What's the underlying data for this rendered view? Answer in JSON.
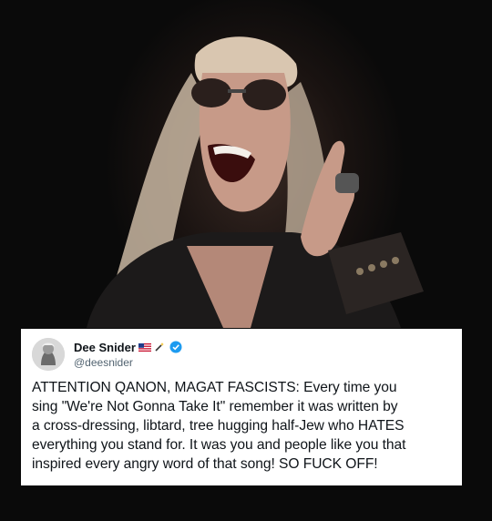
{
  "tweet": {
    "display_name": "Dee Snider",
    "handle": "@deesnider",
    "name_emojis": [
      "us-flag-icon",
      "magic-wand-icon"
    ],
    "verified": true,
    "text_lines": [
      "ATTENTION QANON, MAGAT FASCISTS: Every time you",
      "sing \"We're Not Gonna Take It\" remember it was written by",
      "a cross-dressing, libtard, tree hugging half-Jew who HATES",
      "everything you stand for. It was you and people like you that",
      "inspired every angry word of that song! SO FUCK OFF!"
    ]
  },
  "colors": {
    "background": "#090909",
    "card": "#ffffff",
    "text": "#0f1419",
    "handle": "#536471",
    "verified": "#1d9bf0"
  }
}
